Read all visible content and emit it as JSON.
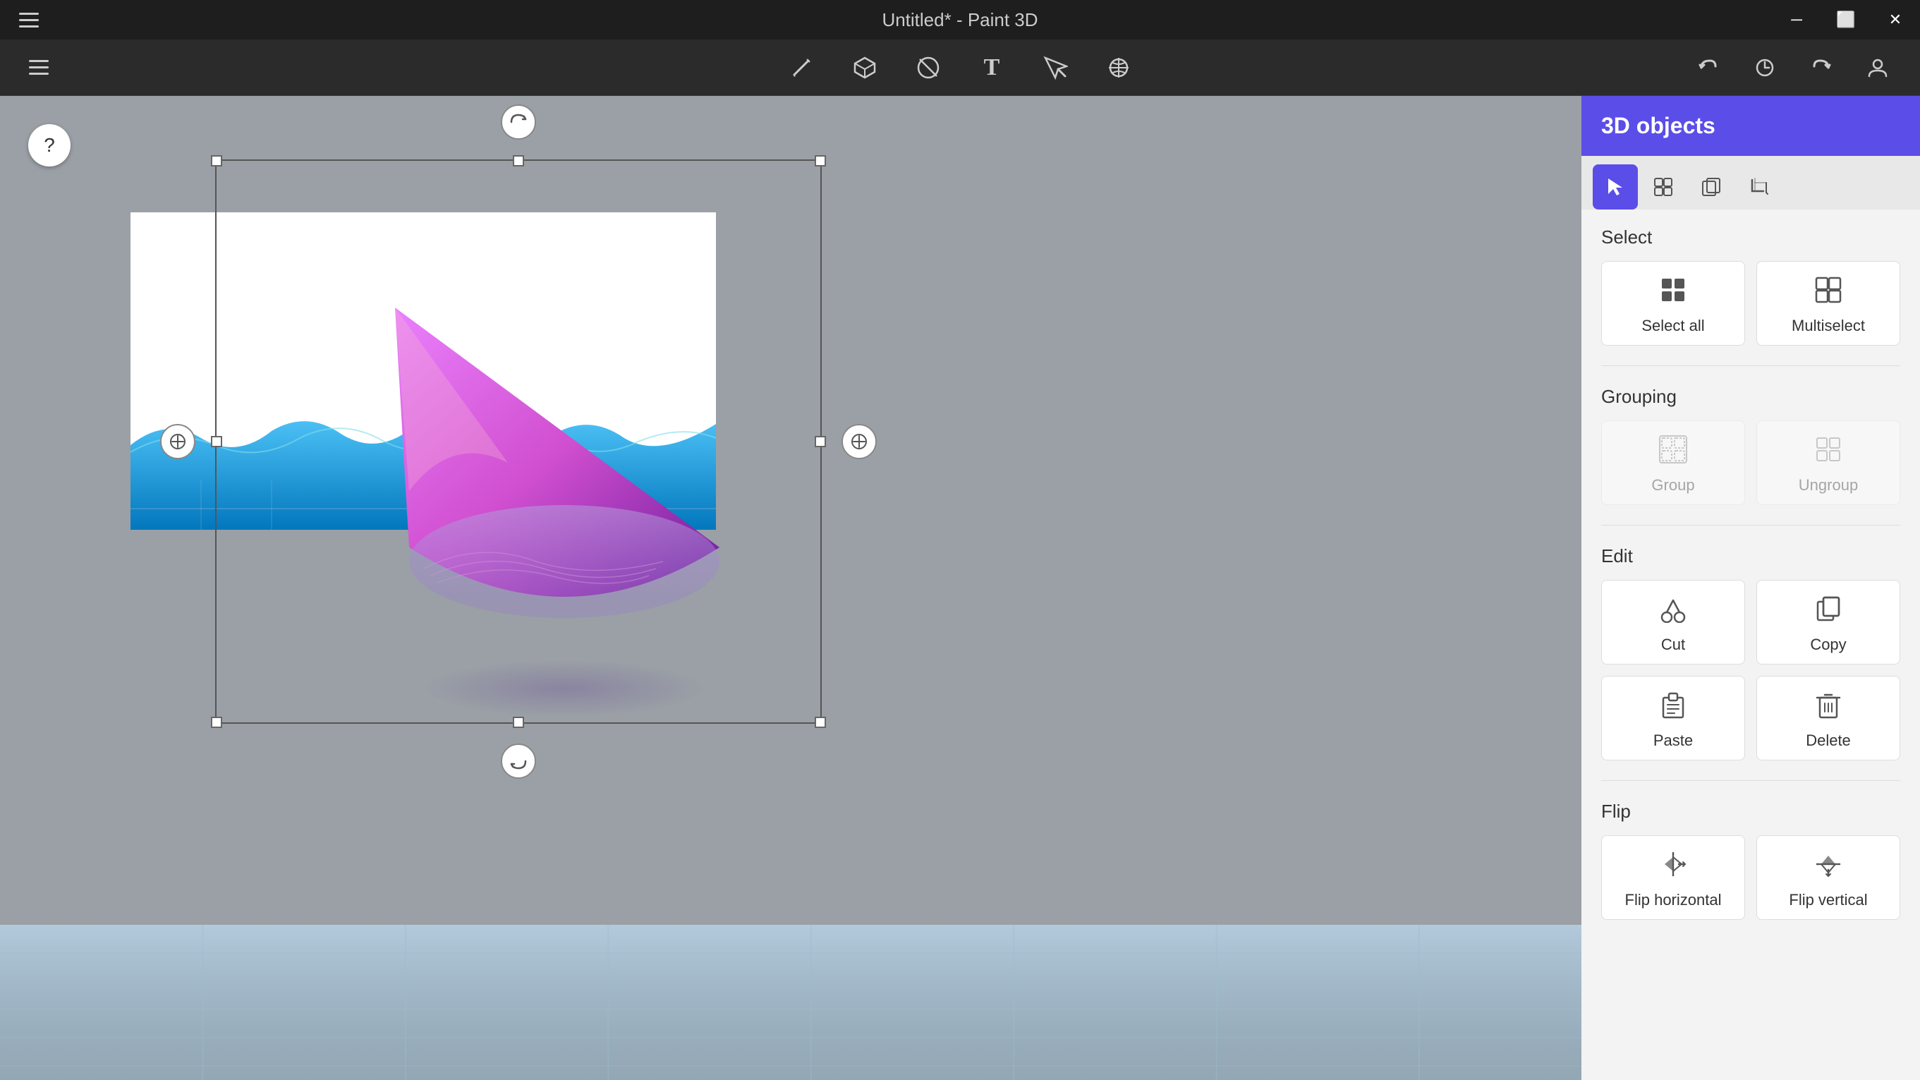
{
  "titlebar": {
    "title": "Untitled* - Paint 3D",
    "controls": {
      "minimize": "─",
      "maximize": "⬜",
      "close": "✕"
    }
  },
  "toolbar": {
    "hamburger_label": "Menu",
    "tools": [
      {
        "id": "brush",
        "label": "Brushes",
        "icon": "✏️"
      },
      {
        "id": "shapes3d",
        "label": "3D shapes",
        "icon": "⬡"
      },
      {
        "id": "erase",
        "label": "Erase",
        "icon": "⊘"
      },
      {
        "id": "text",
        "label": "Text",
        "icon": "T"
      },
      {
        "id": "select",
        "label": "Select",
        "icon": "⤢"
      },
      {
        "id": "effects",
        "label": "Canvas",
        "icon": "✦"
      }
    ],
    "actions": {
      "undo": "↩",
      "history": "🕐",
      "redo": "↪",
      "profile": "👤"
    }
  },
  "canvas": {
    "rotation_handle_top": "↻",
    "rotation_handle_bottom": "↺",
    "side_handle_left": "⊕",
    "side_handle_right": "⊙"
  },
  "panel": {
    "title": "3D objects",
    "tabs": [
      {
        "id": "select",
        "active": true,
        "icon": "cursor"
      },
      {
        "id": "multiselect",
        "active": false,
        "icon": "multiselect"
      },
      {
        "id": "copy",
        "active": false,
        "icon": "copy-obj"
      },
      {
        "id": "crop",
        "active": false,
        "icon": "crop"
      }
    ],
    "select_section": {
      "title": "Select",
      "buttons": [
        {
          "id": "select-all",
          "label": "Select all",
          "icon": "selectall"
        },
        {
          "id": "multiselect",
          "label": "Multiselect",
          "icon": "multiselect"
        }
      ]
    },
    "grouping_section": {
      "title": "Grouping",
      "buttons": [
        {
          "id": "group",
          "label": "Group",
          "icon": "group",
          "disabled": true
        },
        {
          "id": "ungroup",
          "label": "Ungroup",
          "icon": "ungroup",
          "disabled": true
        }
      ]
    },
    "edit_section": {
      "title": "Edit",
      "buttons": [
        {
          "id": "cut",
          "label": "Cut",
          "icon": "cut"
        },
        {
          "id": "copy",
          "label": "Copy",
          "icon": "copy"
        },
        {
          "id": "paste",
          "label": "Paste",
          "icon": "paste"
        },
        {
          "id": "delete",
          "label": "Delete",
          "icon": "delete"
        }
      ]
    },
    "flip_section": {
      "title": "Flip",
      "buttons": [
        {
          "id": "flip-h",
          "label": "Flip horizontal",
          "icon": "fliph"
        },
        {
          "id": "flip-v",
          "label": "Flip vertical",
          "icon": "flipv"
        }
      ]
    }
  }
}
